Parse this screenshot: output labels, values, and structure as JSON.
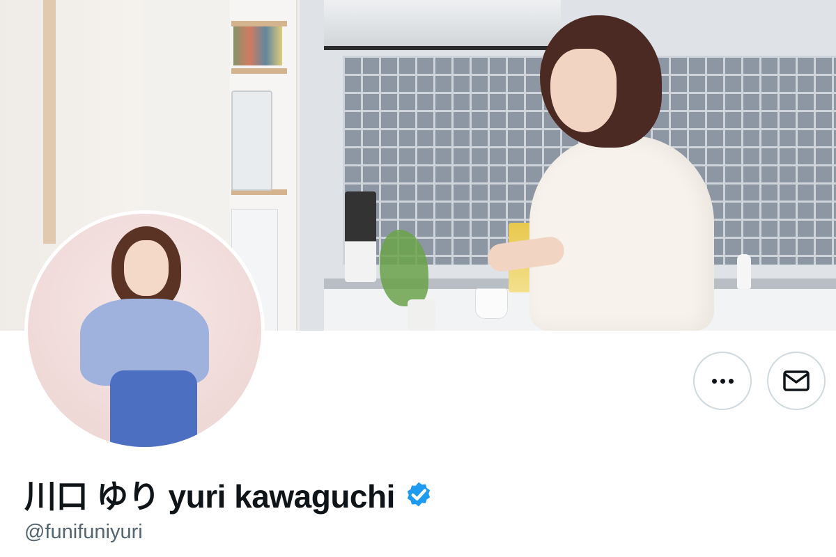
{
  "profile": {
    "display_name": "川口 ゆり yuri kawaguchi",
    "handle": "@funifuniyuri",
    "verified": true,
    "verified_color": "#1d9bf0"
  },
  "banner": {
    "image": "kitchen-photo"
  },
  "avatar": {
    "image": "profile-photo"
  },
  "actions": {
    "more_icon": "more-horizontal-icon",
    "message_icon": "envelope-icon"
  }
}
